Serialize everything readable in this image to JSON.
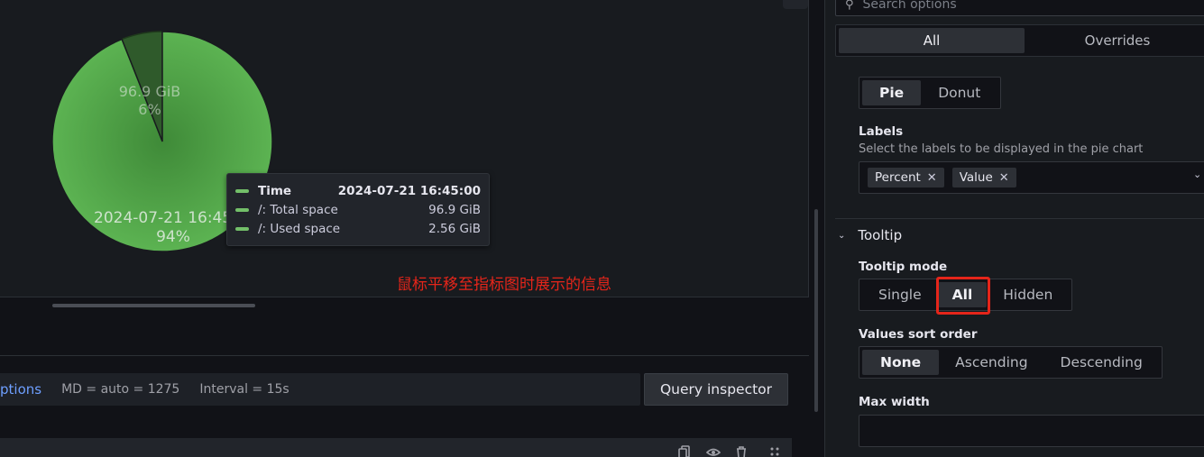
{
  "chart_data": {
    "type": "pie",
    "slices": [
      {
        "name": "/: Total space",
        "value_label": "96.9 GiB",
        "percent": 6,
        "percent_label": "6%",
        "color": "#56a64b",
        "shade": "dim"
      },
      {
        "name": "/: Used space",
        "value_label": "2024-07-21 16:45",
        "percent": 94,
        "percent_label": "94%",
        "color": "#56a64b",
        "shade": "normal"
      }
    ]
  },
  "tooltip": {
    "header": {
      "label": "Time",
      "value": "2024-07-21 16:45:00"
    },
    "rows": [
      {
        "label": "/: Total space",
        "value": "96.9 GiB"
      },
      {
        "label": "/: Used space",
        "value": "2.56 GiB"
      }
    ],
    "swatch_color": "#73bf69"
  },
  "annotation": "鼠标平移至指标图时展示的信息",
  "query": {
    "options_label": "ptions",
    "md": "MD = auto = 1275",
    "interval": "Interval = 15s",
    "inspector_label": "Query inspector"
  },
  "options_pane": {
    "search_placeholder": "Search options",
    "tabs": [
      {
        "label": "All",
        "active": true
      },
      {
        "label": "Overrides",
        "active": false
      }
    ],
    "pie_type": {
      "options": [
        "Pie",
        "Donut"
      ],
      "selected": "Pie"
    },
    "labels": {
      "title": "Labels",
      "description": "Select the labels to be displayed in the pie chart",
      "chips": [
        "Percent",
        "Value"
      ]
    },
    "tooltip_section": {
      "title": "Tooltip",
      "mode_label": "Tooltip mode",
      "modes": [
        "Single",
        "All",
        "Hidden"
      ],
      "mode_selected": "All",
      "sort_label": "Values sort order",
      "sort_options": [
        "None",
        "Ascending",
        "Descending"
      ],
      "sort_selected": "None",
      "max_width_label": "Max width"
    }
  },
  "colors": {
    "accent_link": "#6e9fff",
    "annotation_red": "#e5251a",
    "pie_green": "#56a64b"
  }
}
